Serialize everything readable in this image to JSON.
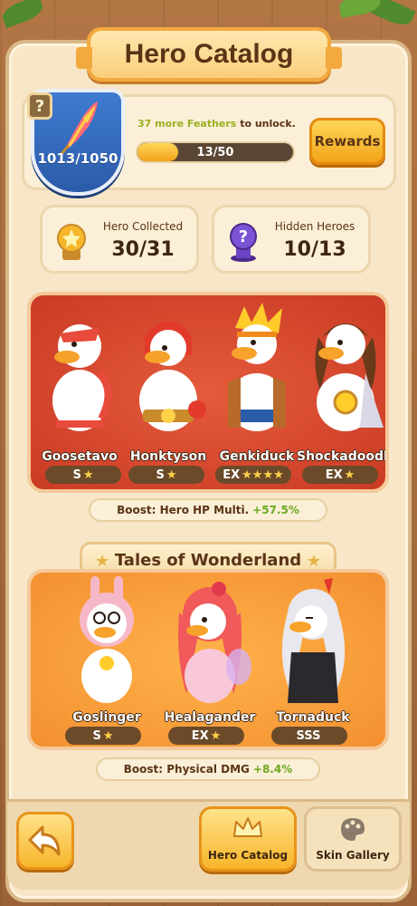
{
  "title": "Hero Catalog",
  "progress": {
    "feathers": "1013/1050",
    "unlock_prefix": "37 more Feathers",
    "unlock_suffix": " to unlock.",
    "bar_label": "13/50",
    "bar_fraction": 0.26,
    "rewards_label": "Rewards"
  },
  "stats": [
    {
      "label": "Hero Collected",
      "value": "30/31",
      "icon": "star-medal-icon"
    },
    {
      "label": "Hidden Heroes",
      "value": "10/13",
      "icon": "question-chess-icon"
    }
  ],
  "section1": {
    "heroes": [
      {
        "name": "Goosetavo",
        "rank": "S",
        "stars": "★"
      },
      {
        "name": "Honktyson",
        "rank": "S",
        "stars": "★"
      },
      {
        "name": "Genkiduck",
        "rank": "EX",
        "stars": "★★★★"
      },
      {
        "name": "Shockadoodle",
        "rank": "EX",
        "stars": "★"
      }
    ],
    "boost_label": "Boost: Hero HP Multi.",
    "boost_value": "+57.5%"
  },
  "section2": {
    "title": "Tales of Wonderland",
    "heroes": [
      {
        "name": "Goslinger",
        "rank": "S",
        "stars": "★"
      },
      {
        "name": "Healagander",
        "rank": "EX",
        "stars": "★"
      },
      {
        "name": "Tornaduck",
        "rank": "SSS",
        "stars": ""
      }
    ],
    "boost_label": "Boost: Physical DMG",
    "boost_value": "+8.4%"
  },
  "nav": {
    "catalog_label": "Hero Catalog",
    "skins_label": "Skin Gallery"
  },
  "colors": {
    "accent": "#f7b52a",
    "red_section": "#c93b24",
    "orange_section": "#f39030",
    "boost_green": "#6aa81e"
  }
}
